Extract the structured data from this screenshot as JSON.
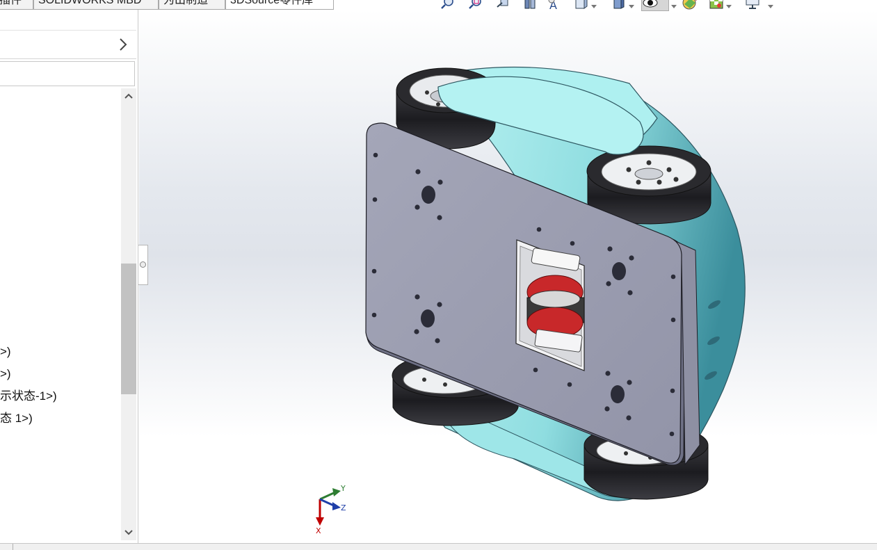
{
  "tabs": [
    {
      "label": "插件"
    },
    {
      "label": "SOLIDWORKS MBD"
    },
    {
      "label": "为出制造"
    },
    {
      "label": "3DSource零件库"
    }
  ],
  "tree": {
    "items": [
      {
        "label": ">)"
      },
      {
        "label": ">)"
      },
      {
        "label": "示状态-1>)"
      },
      {
        "label": "态 1>)"
      }
    ]
  },
  "triad": {
    "x_label": "X",
    "y_label": "Y",
    "z_label": "Z"
  },
  "hud_icons": [
    "zoom-to-fit-icon",
    "zoom-to-area-icon",
    "previous-view-icon",
    "section-view-icon",
    "dynamic-annotation-icon",
    "view-orientation-icon",
    "display-style-icon",
    "hide-show-items-icon",
    "edit-appearance-icon",
    "apply-scene-icon",
    "view-settings-icon"
  ],
  "colors": {
    "plate": "#9ea0b3",
    "shell": "#a6eaec",
    "tire": "#2a2a2e",
    "roller": "#c8282a",
    "axis_x": "#c00000",
    "axis_y": "#2e7d32",
    "axis_z": "#1f3fa8"
  }
}
